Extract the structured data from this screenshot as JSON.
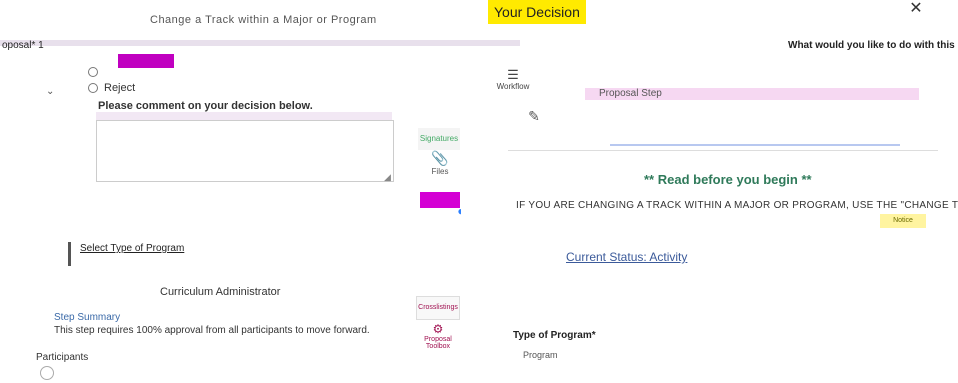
{
  "header": {
    "top_title": "Change a Track within a Major or Program",
    "proposal_label": "oposal* 1",
    "decision_title": "Your Decision",
    "close_glyph": "✕",
    "what_question": "What would you like to do with this p"
  },
  "decision": {
    "reject_label": "Reject",
    "comment_label": "Please comment on your decision below.",
    "comment_value": ""
  },
  "toolbar": {
    "workflow_label": "Workflow",
    "signatures_label": "Signatures",
    "files_label": "Files",
    "crosslistings_label": "Crosslistings",
    "proposal_toolbox_label": "Proposal Toolbox"
  },
  "right": {
    "proposal_step": "Proposal Step",
    "read_before": "** Read before you begin **",
    "if_you_are": "IF YOU ARE CHANGING A TRACK WITHIN A MAJOR OR PROGRAM, USE THE \"CHANGE TO",
    "notice_label": "Notice",
    "current_status": "Current Status: Activity",
    "type_of_program_label": "Type of Program*",
    "program_value": "Program"
  },
  "left_bottom": {
    "select_type": "Select Type of Program",
    "curriculum_admin": "Curriculum Administrator",
    "step_summary_title": "Step Summary",
    "step_summary_text": "This step requires 100% approval from all participants to move forward.",
    "participants_label": "Participants"
  },
  "colors": {
    "decision_yellow": "#ffea00",
    "magenta": "#d400d4",
    "read_green": "#2f7a5a"
  }
}
